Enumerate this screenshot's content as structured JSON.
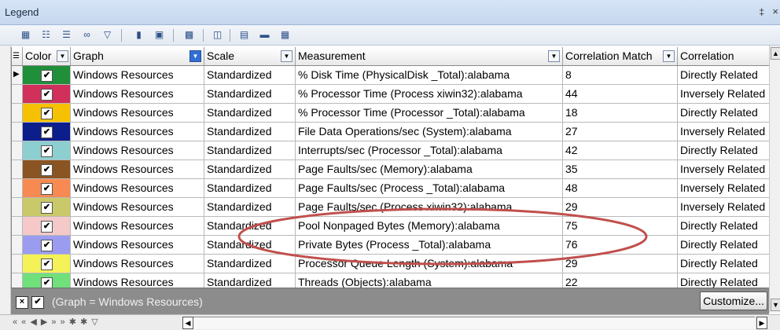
{
  "panel": {
    "title": "Legend",
    "pin_glyph": "‡",
    "close_glyph": "×"
  },
  "toolbar": {
    "icons": [
      "grid-layout-icon",
      "select-all-icon",
      "select-icon",
      "link-icon",
      "filter-icon",
      "folder-icon",
      "window-icon",
      "print-icon",
      "columns-icon",
      "group-icon",
      "highlight-icon",
      "table-icon"
    ]
  },
  "columns": {
    "color": "Color",
    "graph": "Graph",
    "scale": "Scale",
    "measurement": "Measurement",
    "correlation_match": "Correlation Match",
    "correlation": "Correlation"
  },
  "rows": [
    {
      "color": "#1f8f3a",
      "checked": "✔",
      "graph": "Windows Resources",
      "scale": "Standardized",
      "measurement": "% Disk Time (PhysicalDisk _Total):alabama",
      "match": "8",
      "correlation": "Directly Related"
    },
    {
      "color": "#d0305a",
      "checked": "✔",
      "graph": "Windows Resources",
      "scale": "Standardized",
      "measurement": "% Processor Time (Process xiwin32):alabama",
      "match": "44",
      "correlation": "Inversely Related"
    },
    {
      "color": "#f6c100",
      "checked": "✔",
      "graph": "Windows Resources",
      "scale": "Standardized",
      "measurement": "% Processor Time (Processor _Total):alabama",
      "match": "18",
      "correlation": "Directly Related"
    },
    {
      "color": "#0c1d8c",
      "checked": "✔",
      "graph": "Windows Resources",
      "scale": "Standardized",
      "measurement": "File Data Operations/sec (System):alabama",
      "match": "27",
      "correlation": "Inversely Related"
    },
    {
      "color": "#8dcfd0",
      "checked": "✔",
      "graph": "Windows Resources",
      "scale": "Standardized",
      "measurement": "Interrupts/sec (Processor _Total):alabama",
      "match": "42",
      "correlation": "Directly Related"
    },
    {
      "color": "#8a5522",
      "checked": "✔",
      "graph": "Windows Resources",
      "scale": "Standardized",
      "measurement": "Page Faults/sec (Memory):alabama",
      "match": "35",
      "correlation": "Inversely Related"
    },
    {
      "color": "#f78a52",
      "checked": "✔",
      "graph": "Windows Resources",
      "scale": "Standardized",
      "measurement": "Page Faults/sec (Process _Total):alabama",
      "match": "48",
      "correlation": "Inversely Related"
    },
    {
      "color": "#c9c96a",
      "checked": "✔",
      "graph": "Windows Resources",
      "scale": "Standardized",
      "measurement": "Page Faults/sec (Process xiwin32):alabama",
      "match": "29",
      "correlation": "Inversely Related"
    },
    {
      "color": "#f5c9c9",
      "checked": "✔",
      "graph": "Windows Resources",
      "scale": "Standardized",
      "measurement": "Pool Nonpaged Bytes (Memory):alabama",
      "match": "75",
      "correlation": "Directly Related"
    },
    {
      "color": "#9b9cf0",
      "checked": "✔",
      "graph": "Windows Resources",
      "scale": "Standardized",
      "measurement": "Private Bytes (Process _Total):alabama",
      "match": "76",
      "correlation": "Directly Related"
    },
    {
      "color": "#f4f258",
      "checked": "✔",
      "graph": "Windows Resources",
      "scale": "Standardized",
      "measurement": "Processor Queue Length (System):alabama",
      "match": "29",
      "correlation": "Directly Related"
    },
    {
      "color": "#6fe07a",
      "checked": "✔",
      "graph": "Windows Resources",
      "scale": "Standardized",
      "measurement": "Threads (Objects):alabama",
      "match": "22",
      "correlation": "Directly Related"
    }
  ],
  "filter": {
    "close_glyph": "×",
    "check_glyph": "✔",
    "text": "(Graph = Windows Resources)",
    "customize_label": "Customize..."
  },
  "navigator": {
    "buttons": "« « ◀ ▶ » » ✱ ✱ ▽"
  },
  "annotation": {
    "ring_color": "#c0504d"
  }
}
